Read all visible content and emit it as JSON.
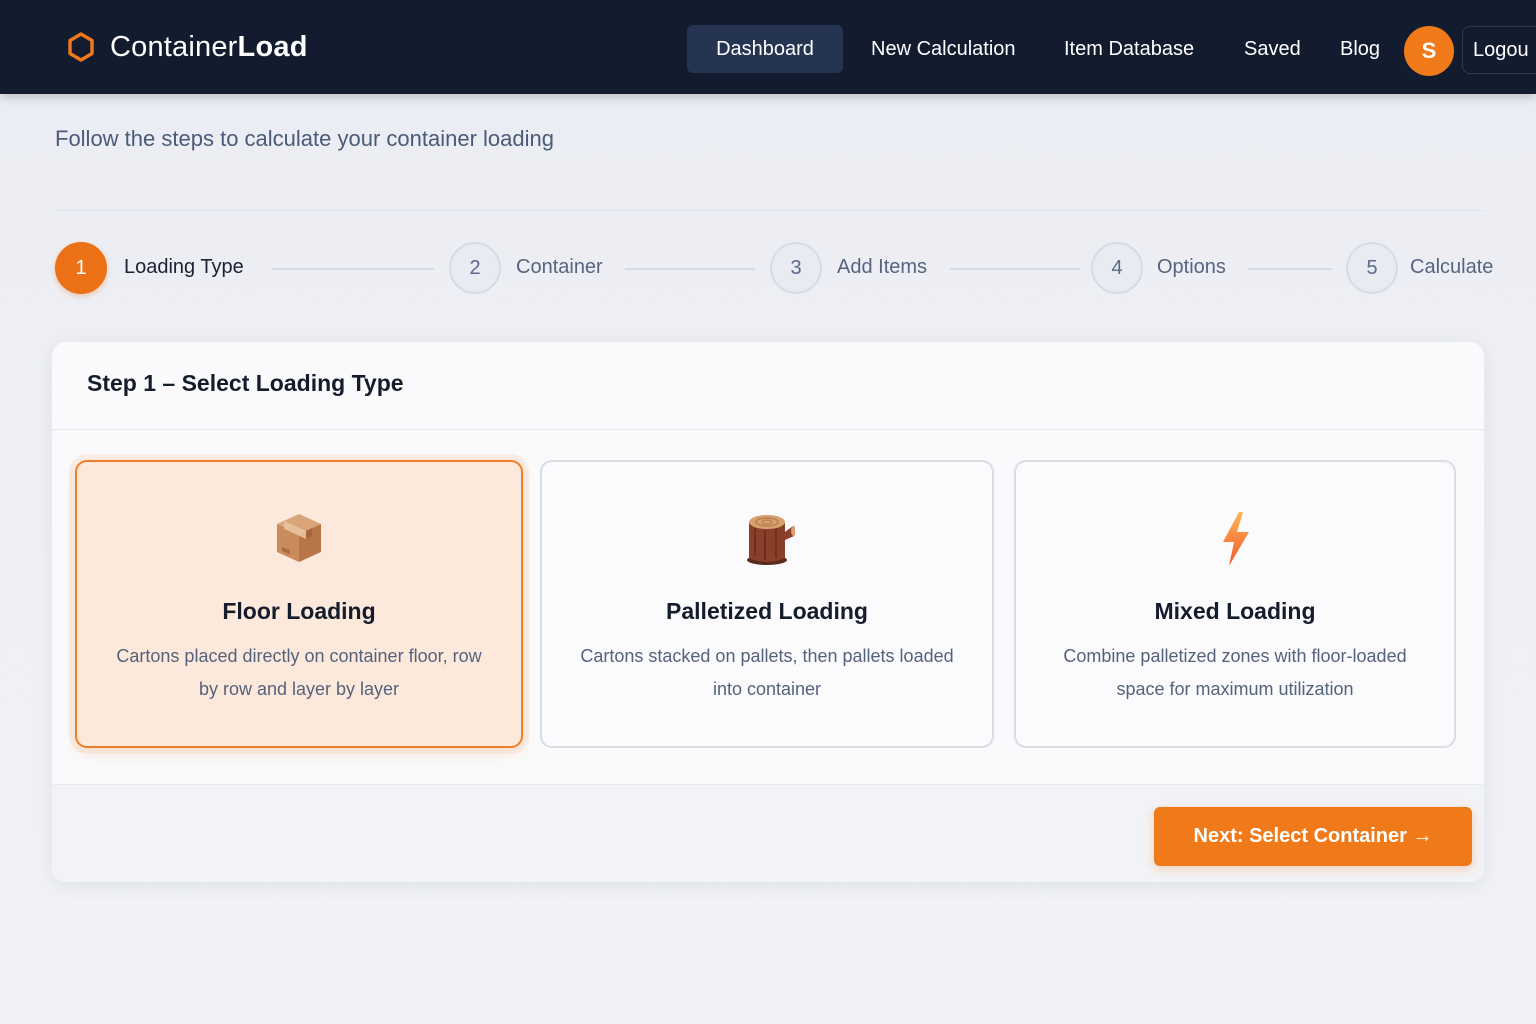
{
  "app": {
    "brand_light": "Container",
    "brand_bold": "Load",
    "accent_color": "#F07A1A",
    "nav_background": "#131B2E"
  },
  "nav": {
    "items": [
      {
        "label": "Dashboard",
        "active": true
      },
      {
        "label": "New Calculation",
        "active": false
      },
      {
        "label": "Item Database",
        "active": false
      },
      {
        "label": "Saved",
        "active": false
      },
      {
        "label": "Blog",
        "active": false
      }
    ],
    "avatar_initial": "S",
    "logout_label": "Logou"
  },
  "intro": {
    "text": "Follow the steps to calculate your container loading"
  },
  "stepper": {
    "steps": [
      {
        "number": "1",
        "label": "Loading Type",
        "active": true
      },
      {
        "number": "2",
        "label": "Container",
        "active": false
      },
      {
        "number": "3",
        "label": "Add Items",
        "active": false
      },
      {
        "number": "4",
        "label": "Options",
        "active": false
      },
      {
        "number": "5",
        "label": "Calculate",
        "active": false
      }
    ]
  },
  "step_card": {
    "title": "Step 1 – Select Loading Type",
    "options": [
      {
        "icon": "cardboard-box-icon",
        "title": "Floor Loading",
        "description": "Cartons placed directly on container floor, row by row and layer by layer",
        "selected": true
      },
      {
        "icon": "wood-log-icon",
        "title": "Palletized Loading",
        "description": "Cartons stacked on pallets, then pallets loaded into container",
        "selected": false
      },
      {
        "icon": "lightning-bolt-icon",
        "title": "Mixed Loading",
        "description": "Combine palletized zones with floor-loaded space for maximum utilization",
        "selected": false
      }
    ],
    "next_button_label": "Next: Select Container →"
  }
}
